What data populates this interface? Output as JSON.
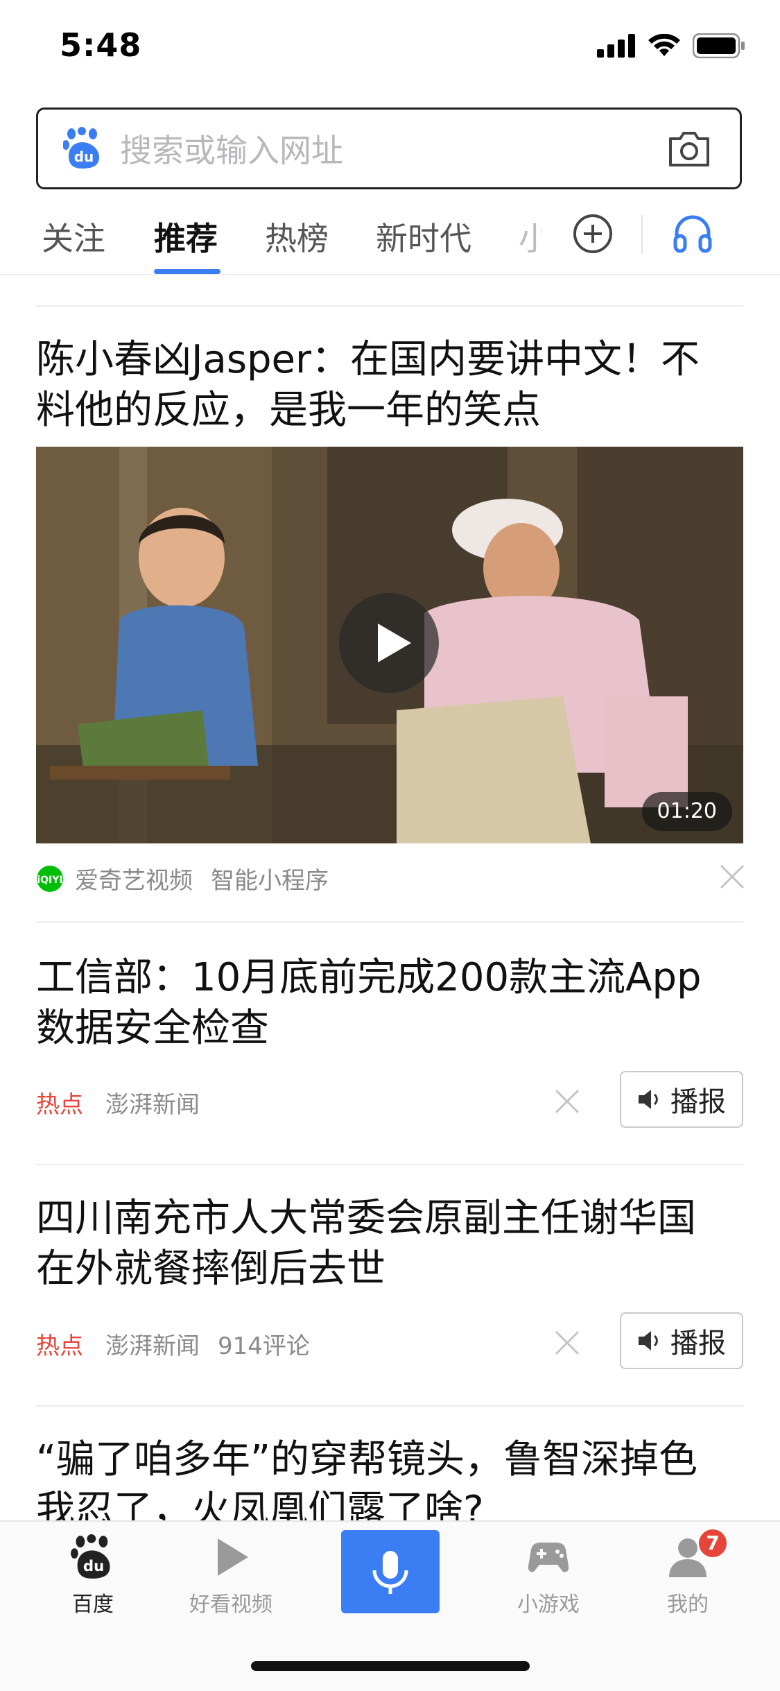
{
  "status": {
    "time": "5:48"
  },
  "search": {
    "placeholder": "搜索或输入网址"
  },
  "tabs": {
    "items": [
      "关注",
      "推荐",
      "热榜",
      "新时代"
    ],
    "active_index": 1,
    "truncated_label": "小"
  },
  "feed": [
    {
      "title_line1": "陈小春凶Jasper：在国内要讲中文！不",
      "title_line2": "料他的反应，是我一年的笑点",
      "type": "video",
      "duration": "01:20",
      "source": "爱奇艺视频",
      "source_badge": "iQIYI",
      "tag": "智能小程序"
    },
    {
      "title_line1": "工信部：10月底前完成200款主流App",
      "title_line2": "数据安全检查",
      "hot_label": "热点",
      "source": "澎湃新闻",
      "comments": "",
      "broadcast_label": "播报"
    },
    {
      "title_line1": "四川南充市人大常委会原副主任谢华国",
      "title_line2": "在外就餐摔倒后去世",
      "hot_label": "热点",
      "source": "澎湃新闻",
      "comments": "914评论",
      "broadcast_label": "播报"
    },
    {
      "title_line1": "“骗了咱多年”的穿帮镜头，鲁智深掉色",
      "title_line2": "我忍了，火凤凰们露了啥?"
    }
  ],
  "tabbar": {
    "items": [
      {
        "label": "百度",
        "icon": "baidu-paw-icon",
        "active": true
      },
      {
        "label": "好看视频",
        "icon": "play-icon"
      },
      {
        "label": "",
        "icon": "microphone-icon"
      },
      {
        "label": "小游戏",
        "icon": "gamepad-icon"
      },
      {
        "label": "我的",
        "icon": "user-icon"
      }
    ],
    "badge_count": "7"
  },
  "colors": {
    "accent": "#3b7df3",
    "hot": "#e5453a",
    "iqiyi": "#00be06"
  }
}
